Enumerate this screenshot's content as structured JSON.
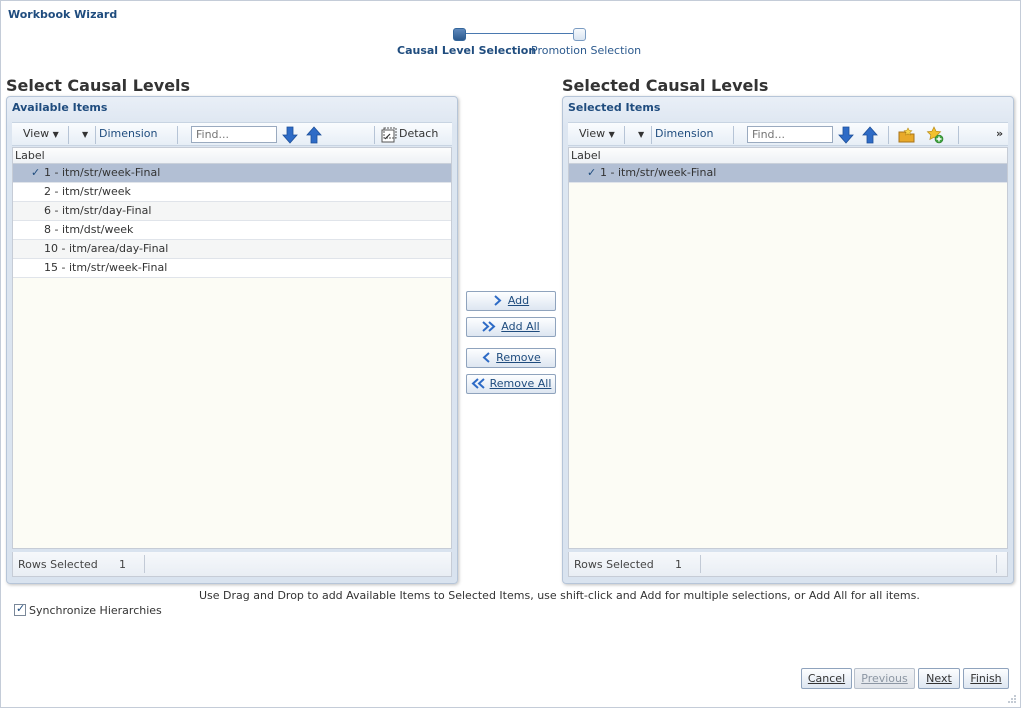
{
  "window": {
    "title": "Workbook Wizard"
  },
  "train": {
    "steps": [
      {
        "label": "Causal Level Selection",
        "state": "current"
      },
      {
        "label": "Promotion Selection",
        "state": "next"
      }
    ]
  },
  "left": {
    "section_title": "Select Causal Levels",
    "panel_title": "Available Items",
    "toolbar": {
      "view_label": "View",
      "dimension_label": "Dimension",
      "find_placeholder": "Find...",
      "detach_label": "Detach"
    },
    "column_header": "Label",
    "rows": [
      {
        "label": "1 - itm/str/week-Final",
        "selected": true
      },
      {
        "label": "2 - itm/str/week",
        "selected": false
      },
      {
        "label": "6 - itm/str/day-Final",
        "selected": false
      },
      {
        "label": "8 - itm/dst/week",
        "selected": false
      },
      {
        "label": "10 - itm/area/day-Final",
        "selected": false
      },
      {
        "label": "15 - itm/str/week-Final",
        "selected": false
      }
    ],
    "status": {
      "label": "Rows Selected",
      "count": "1"
    }
  },
  "right": {
    "section_title": "Selected Causal Levels",
    "panel_title": "Selected Items",
    "toolbar": {
      "view_label": "View",
      "dimension_label": "Dimension",
      "find_placeholder": "Find...",
      "overflow_label": "»"
    },
    "column_header": "Label",
    "rows": [
      {
        "label": "1 - itm/str/week-Final",
        "selected": true
      }
    ],
    "status": {
      "label": "Rows Selected",
      "count": "1"
    }
  },
  "shuttle": {
    "add": "Add",
    "add_all": "Add All",
    "remove": "Remove",
    "remove_all": "Remove All"
  },
  "hint": "Use Drag and Drop to add Available Items to Selected Items, use shift-click and Add for multiple selections, or Add All for all items.",
  "sync": {
    "label": "Synchronize Hierarchies",
    "checked": true
  },
  "footer": {
    "cancel": "Cancel",
    "previous": "Previous",
    "next": "Next",
    "finish": "Finish"
  },
  "colors": {
    "accent": "#1f4c7e",
    "selected_row": "#b2bfd4",
    "panel_bg": "#dde6f1",
    "icon_blue": "#2e6bc6",
    "icon_gold": "#e8a92a"
  }
}
